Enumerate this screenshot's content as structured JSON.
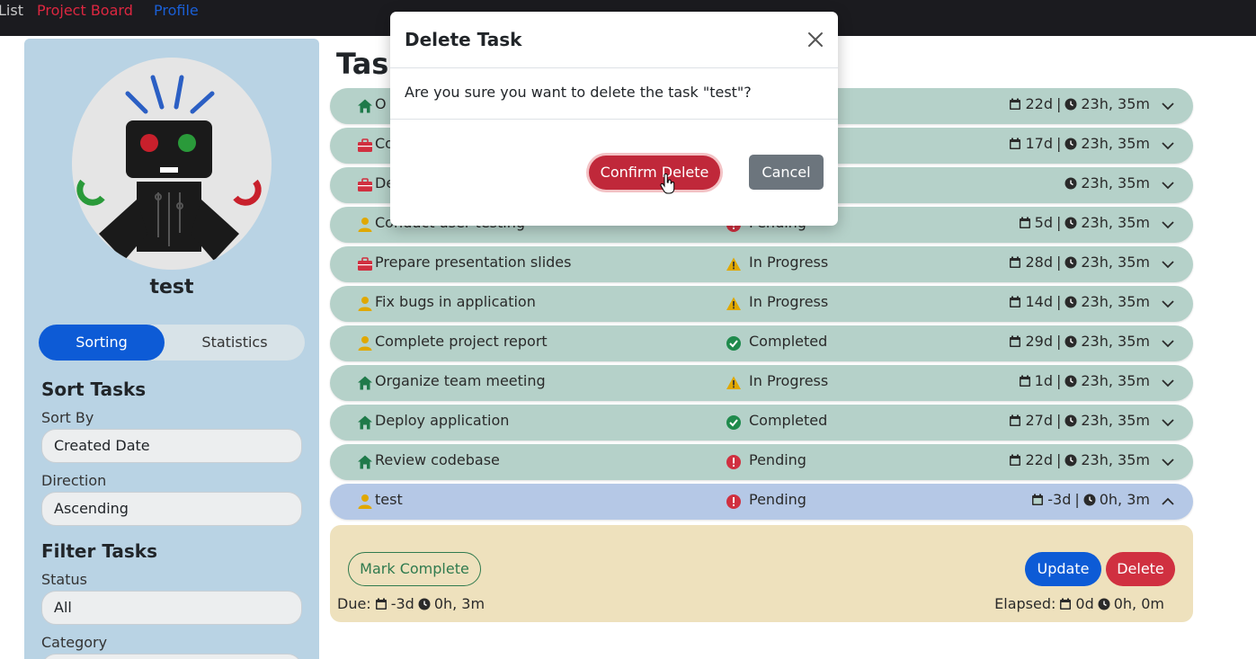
{
  "nav": {
    "list_label": "List",
    "board_label": "Project Board",
    "profile_label": "Profile"
  },
  "sidebar": {
    "username": "test",
    "tabs": {
      "sorting": "Sorting",
      "statistics": "Statistics"
    },
    "sort_heading": "Sort Tasks",
    "sort_by_label": "Sort By",
    "sort_by_value": "Created Date",
    "direction_label": "Direction",
    "direction_value": "Ascending",
    "filter_heading": "Filter Tasks",
    "status_label": "Status",
    "status_value": "All",
    "category_label": "Category"
  },
  "main": {
    "title": "Tasks",
    "tasks": [
      {
        "name": "O",
        "category": "home-icon",
        "status": "",
        "status_icon": "",
        "days": "22d",
        "time": "23h, 35m"
      },
      {
        "name": "Co",
        "category": "briefcase-icon",
        "status": "",
        "status_icon": "",
        "days": "17d",
        "time": "23h, 35m"
      },
      {
        "name": "De",
        "category": "briefcase-icon",
        "status": "",
        "status_icon": "",
        "days": "",
        "time": "23h, 35m"
      },
      {
        "name": "Conduct user testing",
        "category": "user-icon",
        "status": "Pending",
        "status_icon": "pending",
        "days": "5d",
        "time": "23h, 35m"
      },
      {
        "name": "Prepare presentation slides",
        "category": "briefcase-icon",
        "status": "In Progress",
        "status_icon": "progress",
        "days": "28d",
        "time": "23h, 35m"
      },
      {
        "name": "Fix bugs in application",
        "category": "user-icon",
        "status": "In Progress",
        "status_icon": "progress",
        "days": "14d",
        "time": "23h, 35m"
      },
      {
        "name": "Complete project report",
        "category": "user-icon",
        "status": "Completed",
        "status_icon": "completed",
        "days": "29d",
        "time": "23h, 35m"
      },
      {
        "name": "Organize team meeting",
        "category": "home-icon",
        "status": "In Progress",
        "status_icon": "progress",
        "days": "1d",
        "time": "23h, 35m"
      },
      {
        "name": "Deploy application",
        "category": "home-icon",
        "status": "Completed",
        "status_icon": "completed",
        "days": "27d",
        "time": "23h, 35m"
      },
      {
        "name": "Review codebase",
        "category": "home-icon",
        "status": "Pending",
        "status_icon": "pending",
        "days": "22d",
        "time": "23h, 35m"
      },
      {
        "name": "test",
        "category": "user-icon",
        "status": "Pending",
        "status_icon": "pending",
        "days": "-3d",
        "time": "0h, 3m"
      }
    ],
    "details": {
      "mark_complete": "Mark Complete",
      "update": "Update",
      "delete": "Delete",
      "due_label": "Due:",
      "due_days": "-3d",
      "due_time": "0h, 3m",
      "elapsed_label": "Elapsed:",
      "elapsed_days": "0d",
      "elapsed_time": "0h, 0m"
    }
  },
  "modal": {
    "title": "Delete Task",
    "message": "Are you sure you want to delete the task \"test\"?",
    "confirm_label": "Confirm Delete",
    "cancel_label": "Cancel"
  },
  "colors": {
    "nav_bg": "#1b1b1f",
    "sidebar_bg": "#b9d3e4",
    "row_bg": "#b5d1c9",
    "row_active_bg": "#b5c8e6",
    "details_bg": "#eee1bd",
    "primary": "#0d5bd6",
    "danger": "#c0283a",
    "secondary": "#6c757d",
    "pending": "#d03040",
    "progress": "#e0a800",
    "completed": "#1f8a4c"
  }
}
